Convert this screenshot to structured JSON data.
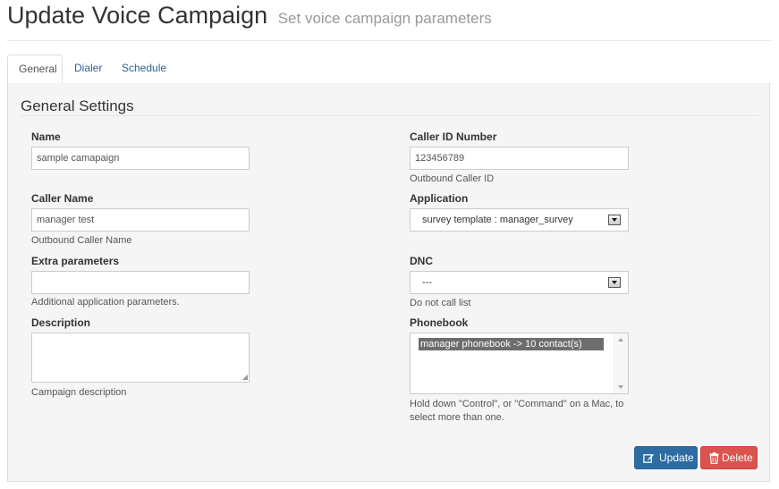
{
  "header": {
    "title": "Update Voice Campaign",
    "subtitle": "Set voice campaign parameters"
  },
  "tabs": [
    {
      "label": "General",
      "active": true
    },
    {
      "label": "Dialer",
      "active": false
    },
    {
      "label": "Schedule",
      "active": false
    }
  ],
  "panel": {
    "legend": "General Settings"
  },
  "form": {
    "name": {
      "label": "Name",
      "value": "sample camapaign"
    },
    "caller_id_number": {
      "label": "Caller ID Number",
      "value": "123456789",
      "help": "Outbound Caller ID"
    },
    "caller_name": {
      "label": "Caller Name",
      "value": "manager test",
      "help": "Outbound Caller Name"
    },
    "application": {
      "label": "Application",
      "selected": "survey template : manager_survey"
    },
    "extra_parameters": {
      "label": "Extra parameters",
      "value": "",
      "help": "Additional application parameters."
    },
    "dnc": {
      "label": "DNC",
      "selected": "---",
      "help": "Do not call list"
    },
    "description": {
      "label": "Description",
      "value": "",
      "help": "Campaign description"
    },
    "phonebook": {
      "label": "Phonebook",
      "options": [
        "manager phonebook -> 10 contact(s)"
      ],
      "selected": "manager phonebook -> 10 contact(s)",
      "help": "Hold down \"Control\", or \"Command\" on a Mac, to select more than one."
    }
  },
  "actions": {
    "update_label": "Update",
    "delete_label": "Delete"
  },
  "icons": {
    "update": "edit-icon",
    "delete": "trash-icon",
    "select_arrow": "chevron-down-icon"
  },
  "colors": {
    "update_button": "#2d6ca2",
    "delete_button": "#d9534f",
    "link": "#2a6496",
    "panel_bg": "#f5f5f5"
  }
}
